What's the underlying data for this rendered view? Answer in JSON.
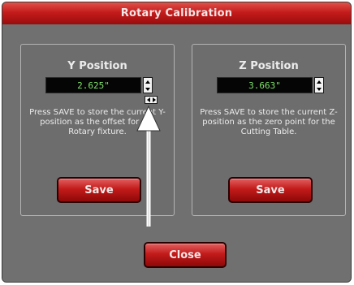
{
  "window": {
    "title": "Rotary Calibration"
  },
  "y_panel": {
    "title": "Y Position",
    "value": "2.625\"",
    "description": "Press SAVE to store the current Y-position as the offset for the Rotary fixture.",
    "save_label": "Save"
  },
  "z_panel": {
    "title": "Z Position",
    "value": "3.663\"",
    "description": "Press SAVE to store the current Z-position as the zero point for the Cutting Table.",
    "save_label": "Save"
  },
  "close_label": "Close",
  "colors": {
    "accent": "#c41c1c",
    "field_text": "#7fe36a",
    "background": "#707070"
  }
}
